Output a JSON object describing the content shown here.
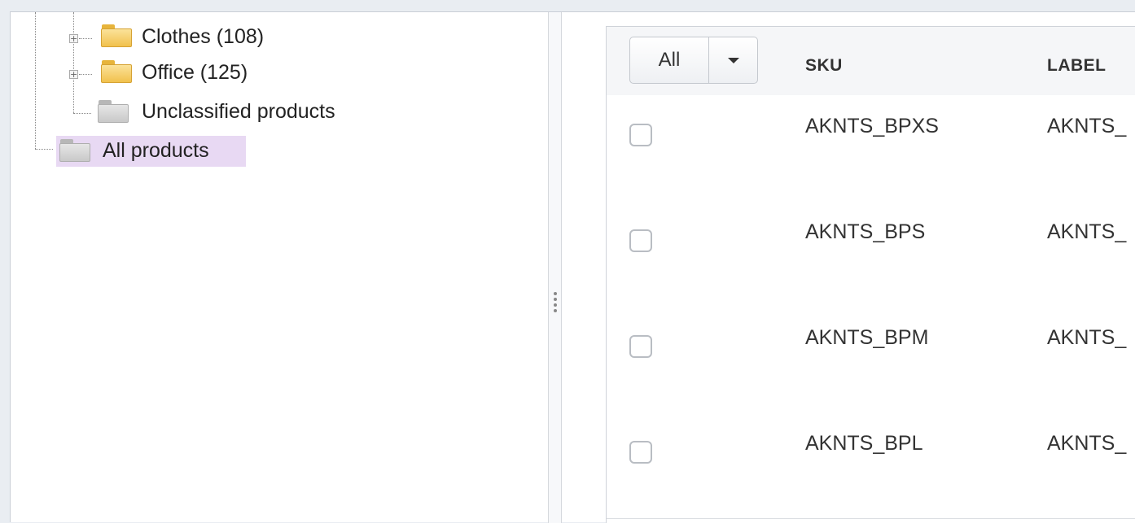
{
  "tree": {
    "items": [
      {
        "label": "Clothes (108)",
        "folder": "yellow",
        "expandable": true
      },
      {
        "label": "Office (125)",
        "folder": "yellow",
        "expandable": true
      },
      {
        "label": "Unclassified products",
        "folder": "gray",
        "expandable": false
      }
    ],
    "root": {
      "label": "All products",
      "folder": "gray",
      "selected": true
    },
    "expand_glyph": "+"
  },
  "grid": {
    "select_all": {
      "label": "All",
      "caret_icon": "caret-down-icon"
    },
    "columns": [
      "SKU",
      "LABEL"
    ],
    "rows": [
      {
        "sku": "AKNTS_BPXS",
        "label": "AKNTS_"
      },
      {
        "sku": "AKNTS_BPS",
        "label": "AKNTS_"
      },
      {
        "sku": "AKNTS_BPM",
        "label": "AKNTS_"
      },
      {
        "sku": "AKNTS_BPL",
        "label": "AKNTS_"
      }
    ]
  },
  "colors": {
    "selected_background": "#e8d9f3",
    "folder_yellow": "#f1c14d",
    "folder_gray": "#c9c9c9"
  }
}
